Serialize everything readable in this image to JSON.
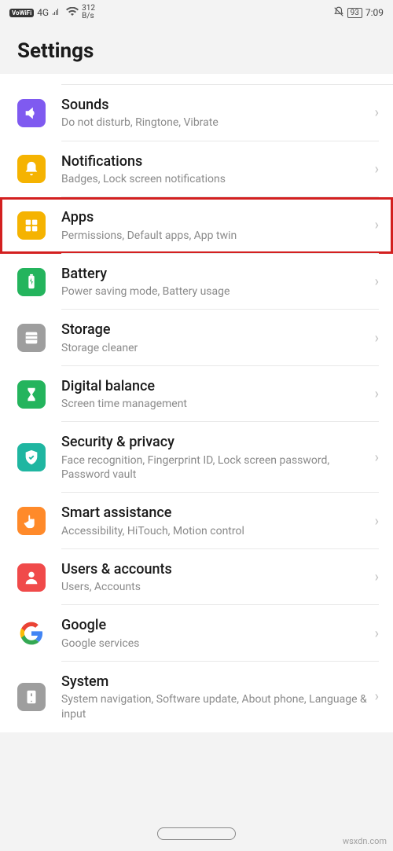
{
  "status": {
    "vowifi": "VoWiFi",
    "net": "4G",
    "speed_num": "312",
    "speed_unit": "B/s",
    "battery": "93",
    "time": "7:09"
  },
  "page_title": "Settings",
  "items": [
    {
      "key": "sounds",
      "title": "Sounds",
      "sub": "Do not disturb, Ringtone, Vibrate",
      "color": "#7f5af0"
    },
    {
      "key": "notifications",
      "title": "Notifications",
      "sub": "Badges, Lock screen notifications",
      "color": "#f5b301"
    },
    {
      "key": "apps",
      "title": "Apps",
      "sub": "Permissions, Default apps, App twin",
      "color": "#f5b301",
      "highlighted": true
    },
    {
      "key": "battery",
      "title": "Battery",
      "sub": "Power saving mode, Battery usage",
      "color": "#24b45d"
    },
    {
      "key": "storage",
      "title": "Storage",
      "sub": "Storage cleaner",
      "color": "#9e9e9e"
    },
    {
      "key": "digital-balance",
      "title": "Digital balance",
      "sub": "Screen time management",
      "color": "#24b45d"
    },
    {
      "key": "security",
      "title": "Security & privacy",
      "sub": "Face recognition, Fingerprint ID, Lock screen password, Password vault",
      "color": "#1fb6a1"
    },
    {
      "key": "smart-assistance",
      "title": "Smart assistance",
      "sub": "Accessibility, HiTouch, Motion control",
      "color": "#ff8a2a"
    },
    {
      "key": "users",
      "title": "Users & accounts",
      "sub": "Users, Accounts",
      "color": "#f04a4a"
    },
    {
      "key": "google",
      "title": "Google",
      "sub": "Google services",
      "color": "google"
    },
    {
      "key": "system",
      "title": "System",
      "sub": "System navigation, Software update, About phone, Language & input",
      "color": "#9e9e9e"
    }
  ],
  "watermark": "wsxdn.com"
}
